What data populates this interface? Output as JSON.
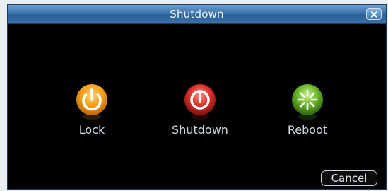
{
  "window": {
    "title": "Shutdown"
  },
  "actions": [
    {
      "label": "Lock",
      "icon": "power-icon",
      "color": "#f4a21e"
    },
    {
      "label": "Shutdown",
      "icon": "power-icon",
      "color": "#d8322a"
    },
    {
      "label": "Reboot",
      "icon": "reboot-icon",
      "color": "#6ab52b"
    }
  ],
  "buttons": {
    "cancel_label": "Cancel"
  }
}
